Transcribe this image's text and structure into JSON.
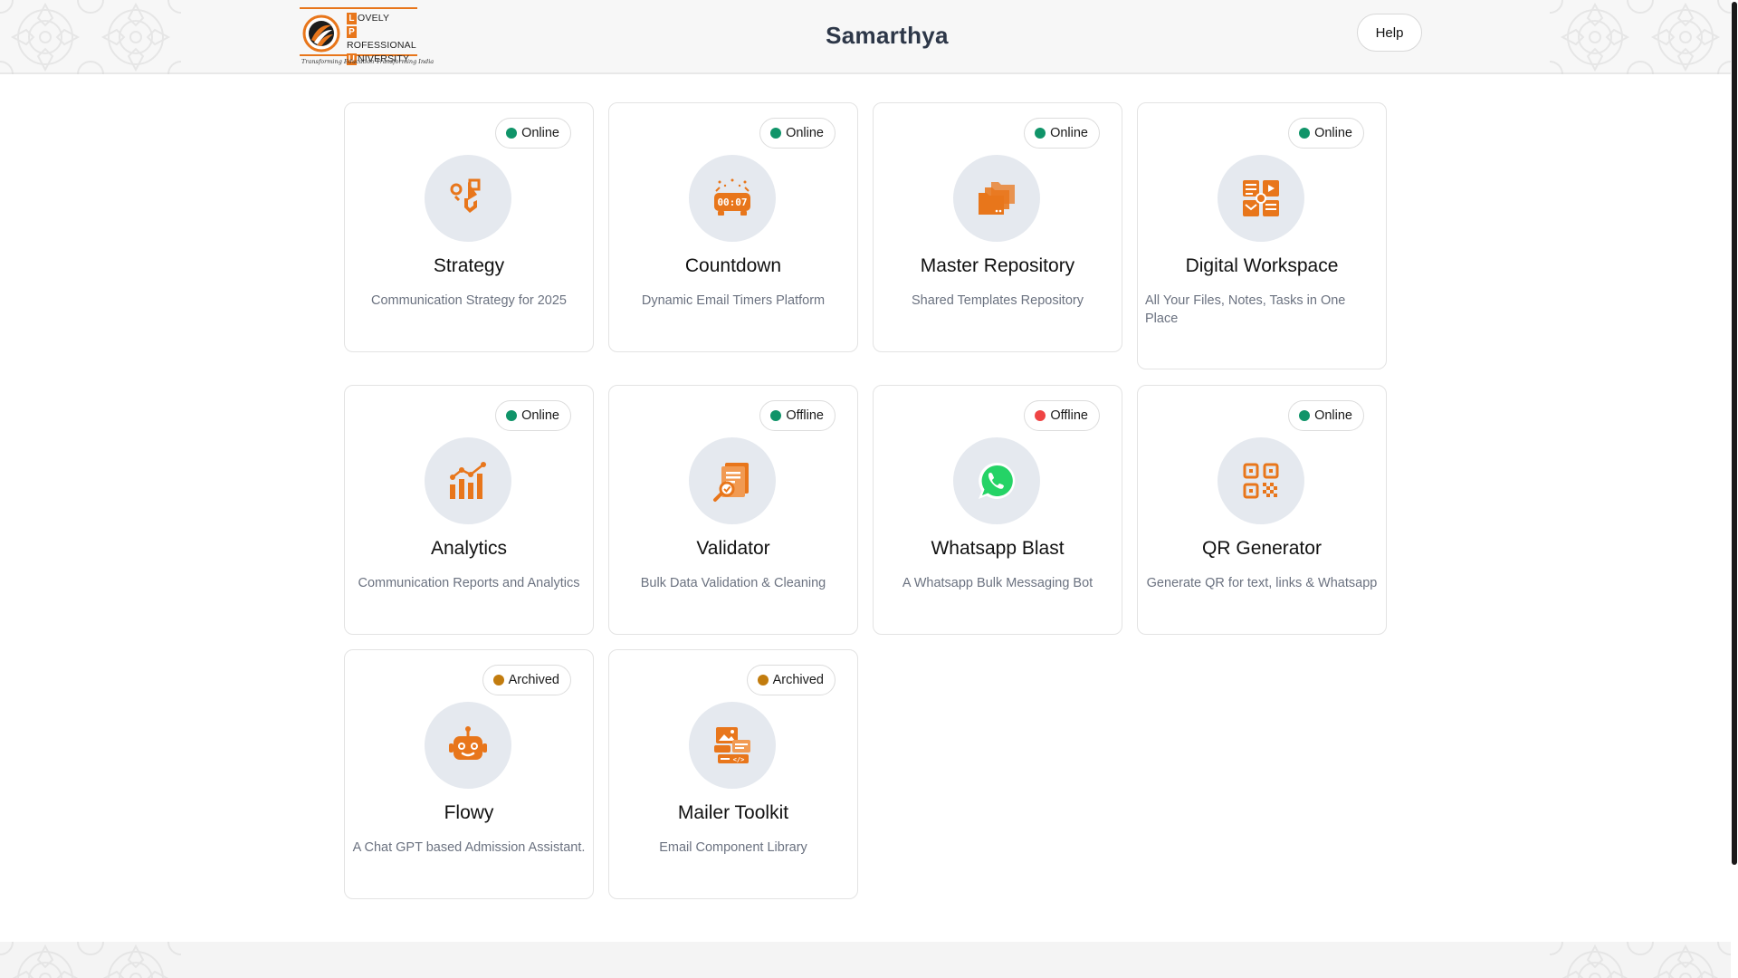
{
  "header": {
    "logo": {
      "line1_cap": "L",
      "line1_rest": "OVELY",
      "line2_cap": "P",
      "line2_rest": "ROFESSIONAL",
      "line3_cap": "U",
      "line3_rest": "NIVERSITY",
      "tagline": "Transforming Education Transforming India"
    },
    "title": "Samarthya",
    "help_label": "Help"
  },
  "status_colors": {
    "Online": "#109469",
    "Offline": "#ef4444",
    "Archived": "#c27c0e"
  },
  "accent_color": "#e8761b",
  "cards": [
    {
      "title": "Strategy",
      "description": "Communication Strategy for 2025",
      "status": "Online",
      "icon": "strategy-icon"
    },
    {
      "title": "Countdown",
      "description": "Dynamic Email Timers Platform",
      "status": "Online",
      "icon": "countdown-timer-icon"
    },
    {
      "title": "Master Repository",
      "description": "Shared Templates Repository",
      "status": "Online",
      "icon": "folders-icon"
    },
    {
      "title": "Digital Workspace",
      "description": "All Your Files, Notes, Tasks in One Place",
      "status": "Online",
      "icon": "workspace-icon"
    },
    {
      "title": "Analytics",
      "description": "Communication Reports and Analytics",
      "status": "Online",
      "icon": "bar-chart-icon"
    },
    {
      "title": "Validator",
      "description": "Bulk Data Validation & Cleaning",
      "status": "Offline",
      "icon": "document-search-icon"
    },
    {
      "title": "Whatsapp Blast",
      "description": "A Whatsapp Bulk Messaging Bot",
      "status": "Offline",
      "icon": "whatsapp-icon"
    },
    {
      "title": "QR Generator",
      "description": "Generate QR for text, links & Whatsapp",
      "status": "Online",
      "icon": "qr-code-icon"
    },
    {
      "title": "Flowy",
      "description": "A Chat GPT based Admission Assistant.",
      "status": "Archived",
      "icon": "robot-icon"
    },
    {
      "title": "Mailer Toolkit",
      "description": "Email Component Library",
      "status": "Archived",
      "icon": "mailer-components-icon"
    }
  ]
}
